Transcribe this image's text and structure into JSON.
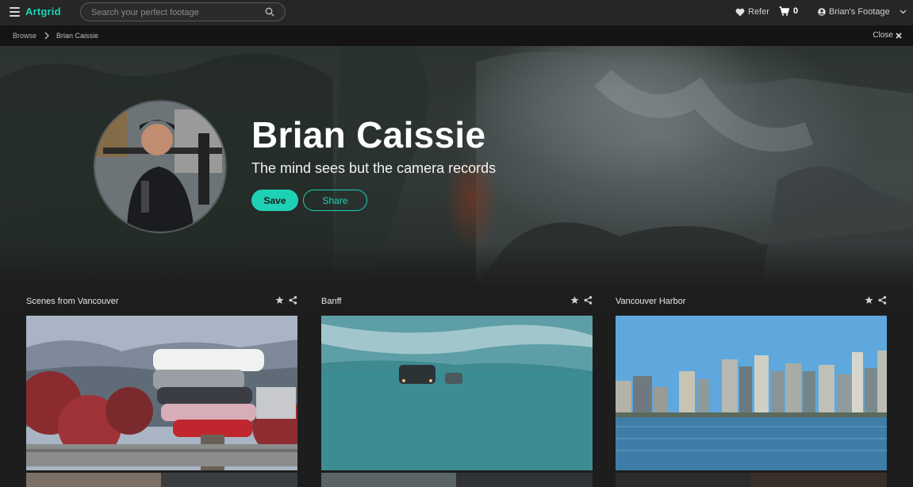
{
  "header": {
    "logo": "Artgrid",
    "search_placeholder": "Search your perfect footage",
    "refer_label": "Refer",
    "cart_count": "0",
    "account_label": "Brian's Footage"
  },
  "breadcrumb": {
    "items": [
      "Browse",
      "Brian Caissie"
    ],
    "close_label": "Close"
  },
  "profile": {
    "name": "Brian Caissie",
    "tagline": "The mind sees but the camera records",
    "save_label": "Save",
    "share_label": "Share"
  },
  "collections": [
    {
      "title": "Scenes from Vancouver"
    },
    {
      "title": "Banff"
    },
    {
      "title": "Vancouver Harbor"
    }
  ],
  "colors": {
    "accent": "#1fd1b4",
    "topbar": "#262626",
    "background": "#1e1e1e"
  }
}
